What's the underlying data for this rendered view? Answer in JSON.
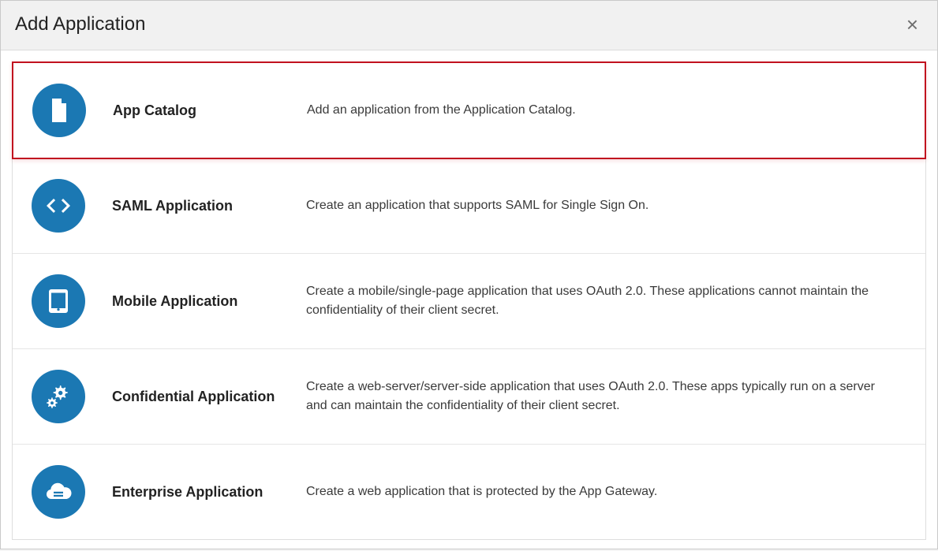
{
  "modal": {
    "title": "Add Application",
    "close_glyph": "×"
  },
  "options": [
    {
      "title": "App Catalog",
      "desc": "Add an application from the Application Catalog.",
      "selected": true
    },
    {
      "title": "SAML Application",
      "desc": "Create an application that supports SAML for Single Sign On.",
      "selected": false
    },
    {
      "title": "Mobile Application",
      "desc": "Create a mobile/single-page application that uses OAuth 2.0. These applications cannot maintain the confidentiality of their client secret.",
      "selected": false
    },
    {
      "title": "Confidential Application",
      "desc": "Create a web-server/server-side application that uses OAuth 2.0. These apps typically run on a server and can maintain the confidentiality of their client secret.",
      "selected": false
    },
    {
      "title": "Enterprise Application",
      "desc": "Create a web application that is protected by the App Gateway.",
      "selected": false
    }
  ],
  "colors": {
    "accent": "#1b78b3",
    "highlight_border": "#c1121f"
  }
}
